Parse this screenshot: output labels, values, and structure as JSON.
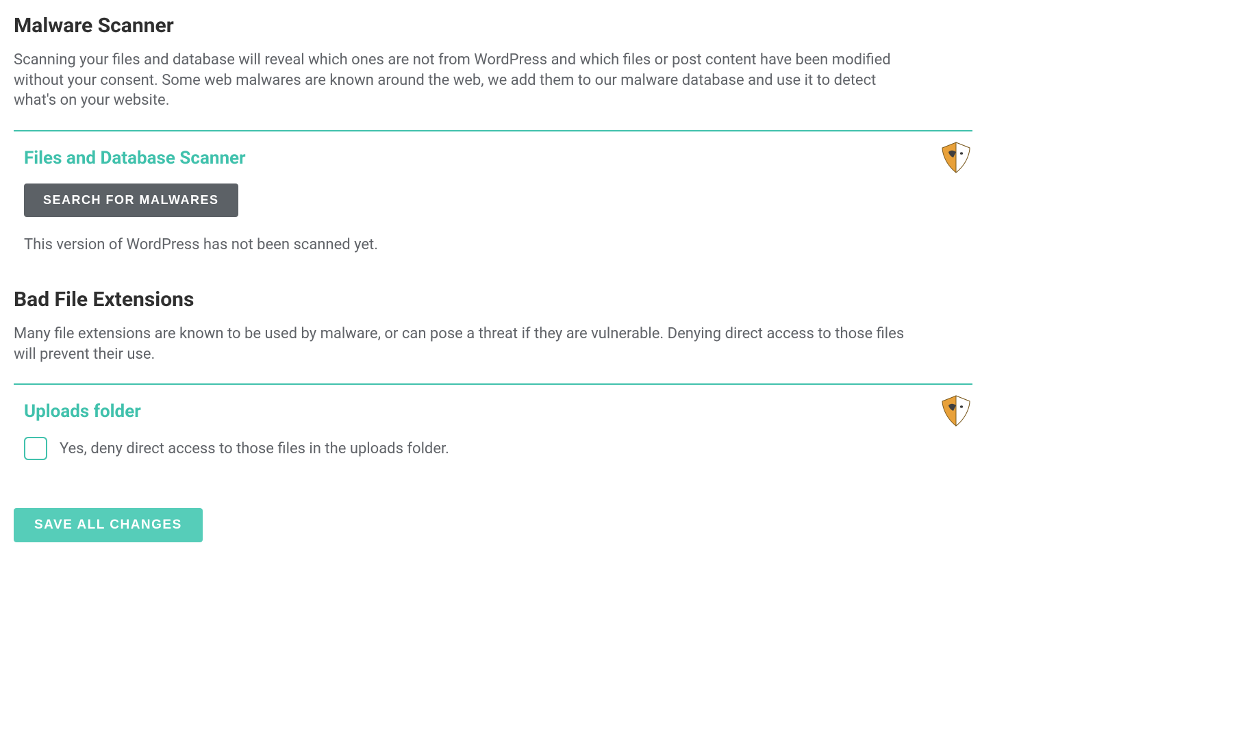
{
  "malware": {
    "heading": "Malware Scanner",
    "desc": "Scanning your files and database will reveal which ones are not from WordPress and which files or post content have been modified without your consent. Some web malwares are known around the web, we add them to our malware database and use it to detect what's on your website.",
    "panel_heading": "Files and Database Scanner",
    "search_button": "SEARCH FOR MALWARES",
    "status": "This version of WordPress has not been scanned yet."
  },
  "bad_ext": {
    "heading": "Bad File Extensions",
    "desc": "Many file extensions are known to be used by malware, or can pose a threat if they are vulnerable. Denying direct access to those files will prevent their use.",
    "panel_heading": "Uploads folder",
    "checkbox_label": "Yes, deny direct access to those files in the uploads folder."
  },
  "save_button": "SAVE ALL CHANGES"
}
